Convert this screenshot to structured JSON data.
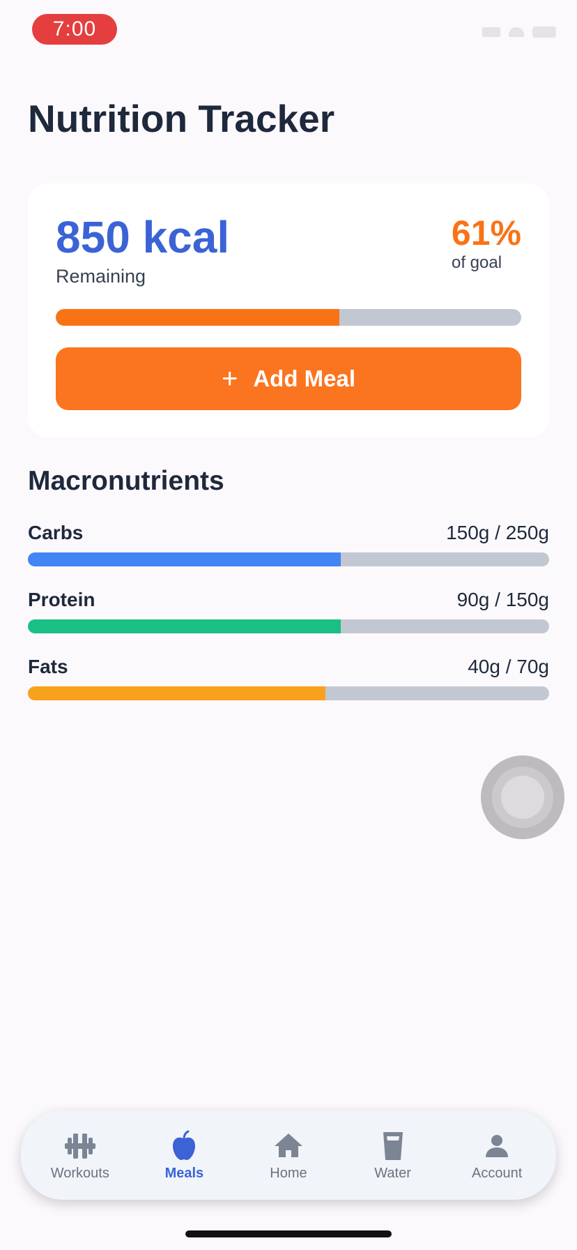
{
  "status_bar": {
    "time": "7:00"
  },
  "header": {
    "title": "Nutrition Tracker"
  },
  "summary": {
    "calories": "850 kcal",
    "calories_label": "Remaining",
    "percent": "61%",
    "percent_label": "of goal",
    "progress_fraction": 0.61,
    "add_button_label": "Add Meal",
    "accent_color": "#f97316"
  },
  "macros": {
    "title": "Macronutrients",
    "items": [
      {
        "name": "Carbs",
        "value": "150g / 250g",
        "fraction": 0.6,
        "color": "#4285f4"
      },
      {
        "name": "Protein",
        "value": "90g / 150g",
        "fraction": 0.6,
        "color": "#1abf85"
      },
      {
        "name": "Fats",
        "value": "40g / 70g",
        "fraction": 0.571,
        "color": "#f8a11c"
      }
    ]
  },
  "tabbar": {
    "items": [
      {
        "label": "Workouts",
        "icon": "dumbbell-icon",
        "active": false
      },
      {
        "label": "Meals",
        "icon": "apple-icon",
        "active": true
      },
      {
        "label": "Home",
        "icon": "home-icon",
        "active": false
      },
      {
        "label": "Water",
        "icon": "glass-icon",
        "active": false
      },
      {
        "label": "Account",
        "icon": "person-icon",
        "active": false
      }
    ]
  }
}
